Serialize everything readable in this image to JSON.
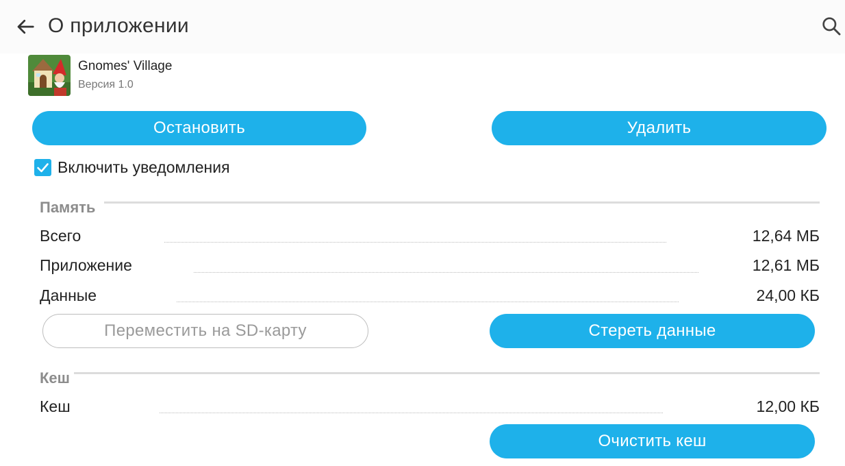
{
  "header": {
    "title": "О приложении",
    "back_icon": "arrow-left-icon",
    "search_icon": "search-icon"
  },
  "app": {
    "name": "Gnomes' Village",
    "version": "Версия 1.0",
    "icon": "gnome-house-icon"
  },
  "actions": {
    "stop_label": "Остановить",
    "delete_label": "Удалить"
  },
  "notifications": {
    "label": "Включить уведомления",
    "checked": true
  },
  "memory": {
    "title": "Память",
    "rows": [
      {
        "label": "Всего",
        "value": "12,64 МБ"
      },
      {
        "label": "Приложение",
        "value": "12,61 МБ"
      },
      {
        "label": "Данные",
        "value": "24,00 КБ"
      }
    ],
    "move_label": "Переместить на SD-карту",
    "clear_data_label": "Стереть данные"
  },
  "cache": {
    "title": "Кеш",
    "rows": [
      {
        "label": "Кеш",
        "value": "12,00 КБ"
      }
    ],
    "clear_cache_label": "Очистить кеш"
  },
  "colors": {
    "accent": "#1eb1ea",
    "section_title": "#8c8c8c",
    "divider": "#dcdcdc"
  }
}
